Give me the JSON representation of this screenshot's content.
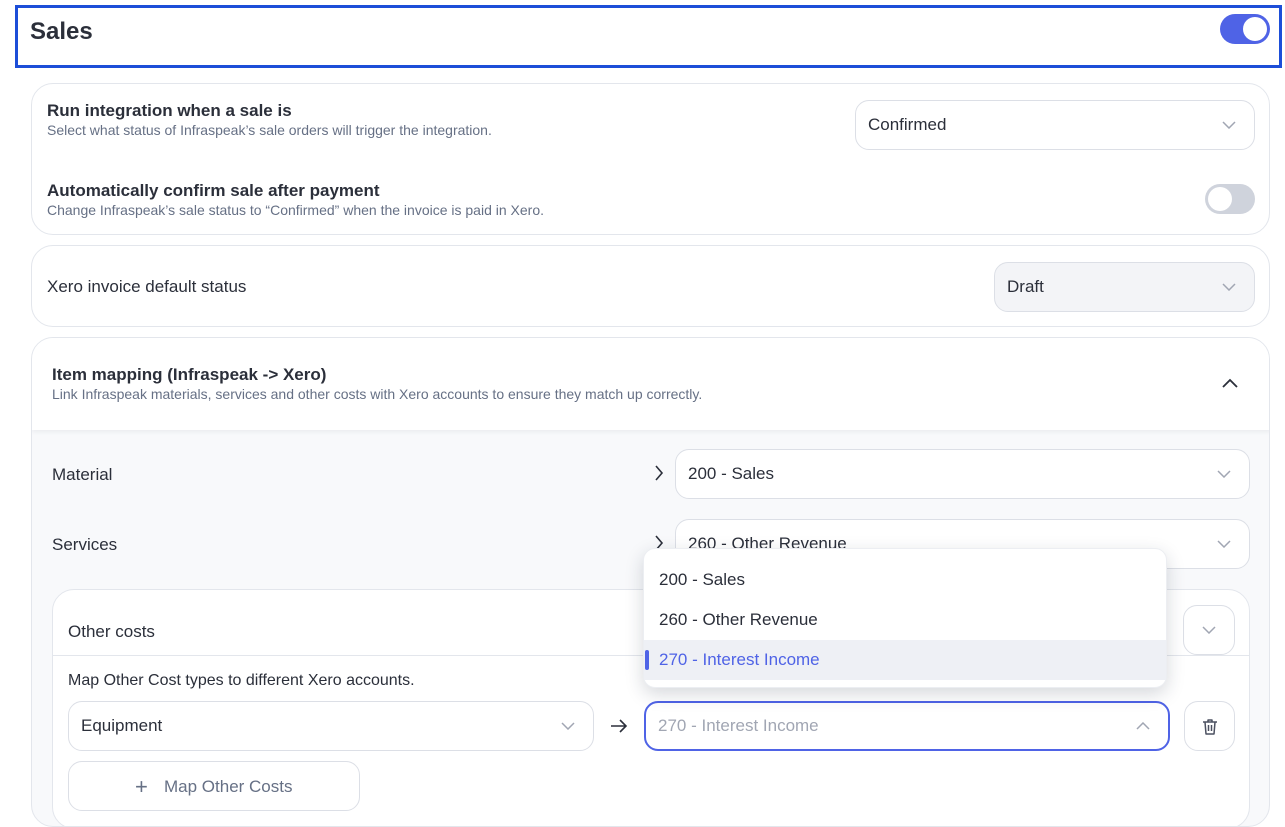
{
  "header": {
    "title": "Sales",
    "enabled": true
  },
  "run_integration": {
    "title": "Run integration when a sale is",
    "description": "Select what status of Infraspeak’s sale orders will trigger the integration.",
    "value": "Confirmed"
  },
  "auto_confirm": {
    "title": "Automatically confirm sale after payment",
    "description": "Change Infraspeak’s sale status to “Confirmed” when the invoice is paid in Xero.",
    "enabled": false
  },
  "invoice_status": {
    "label": "Xero invoice default status",
    "value": "Draft"
  },
  "item_mapping": {
    "title": "Item mapping (Infraspeak -> Xero)",
    "description": "Link Infraspeak materials, services and other costs with Xero accounts to ensure they match up correctly.",
    "rows": [
      {
        "label": "Material",
        "value": "200 - Sales"
      },
      {
        "label": "Services",
        "value": "260 - Other Revenue"
      }
    ],
    "other_costs": {
      "label": "Other costs",
      "instructions": "Map Other Cost types to different Xero accounts.",
      "cost_type": "Equipment",
      "account_placeholder": "270 - Interest Income",
      "add_button": "Map Other Costs",
      "add_symbol": "+"
    }
  },
  "dropdown": {
    "options": [
      "200 - Sales",
      "260 - Other Revenue",
      "270 - Interest Income"
    ],
    "selected": "270 - Interest Income"
  }
}
